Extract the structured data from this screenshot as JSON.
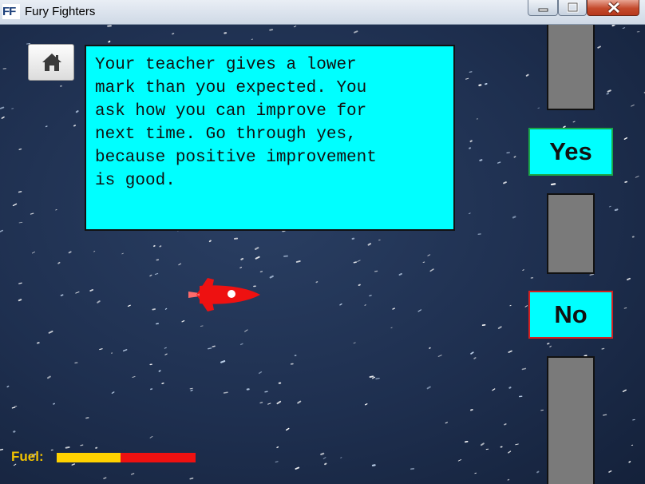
{
  "window": {
    "app_icon_text": "FF",
    "title": "Fury Fighters"
  },
  "game": {
    "question_text": "Your teacher gives a lower\nmark than you expected. You\nask how you can improve for\nnext time. Go through yes,\nbecause positive improvement\nis good.",
    "answers": {
      "yes_label": "Yes",
      "no_label": "No"
    },
    "fuel": {
      "label": "Fuel:",
      "level_fraction": 0.46
    },
    "icons": {
      "home": "home-icon",
      "player": "rocket-icon"
    },
    "colors": {
      "question_background": "#00ffff",
      "answer_background": "#00ffff",
      "yes_border": "#1aa84a",
      "no_border": "#d42020",
      "fuel_remaining": "#ffd200",
      "fuel_empty": "#ee1111",
      "fuel_label": "#f2c200",
      "rocket": "#ee1111",
      "pipe": "#7a7a7a",
      "space": "#1e2f4f"
    }
  }
}
